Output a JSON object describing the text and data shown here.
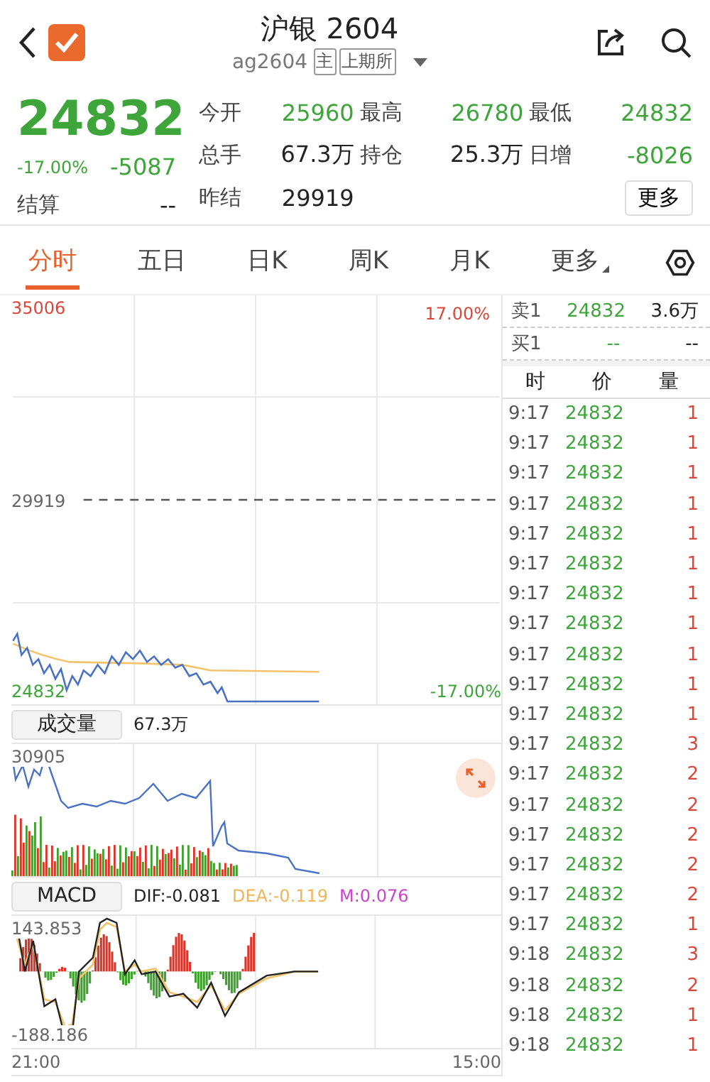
{
  "header": {
    "title": "沪银 2604",
    "code": "ag2604",
    "tags": [
      "主",
      "上期所"
    ]
  },
  "quote": {
    "price": "24832",
    "change_pct": "-17.00%",
    "change": "-5087",
    "stats": [
      {
        "label": "今开",
        "value": "25960",
        "kind": "down"
      },
      {
        "label": "最高",
        "value": "26780",
        "kind": "down"
      },
      {
        "label": "最低",
        "value": "24832",
        "kind": "down"
      },
      {
        "label": "总手",
        "value": "67.3万",
        "kind": "plain"
      },
      {
        "label": "持仓",
        "value": "25.3万",
        "kind": "plain"
      },
      {
        "label": "日增",
        "value": "-8026",
        "kind": "down"
      }
    ],
    "settle": {
      "label": "结算",
      "value": "--"
    },
    "prev_settle": {
      "label": "昨结",
      "value": "29919"
    },
    "more_button": "更多"
  },
  "tabs": [
    {
      "label": "分时",
      "selected": true,
      "kind": "tab"
    },
    {
      "label": "五日",
      "selected": false,
      "kind": "tab"
    },
    {
      "label": "日K",
      "selected": false,
      "kind": "tab"
    },
    {
      "label": "周K",
      "selected": false,
      "kind": "tab"
    },
    {
      "label": "月K",
      "selected": false,
      "kind": "tab"
    },
    {
      "label": "更多",
      "selected": false,
      "kind": "menu"
    }
  ],
  "price_chart": {
    "top_price": "35006",
    "top_pct": "17.00%",
    "mid_price": "29919",
    "bottom_price": "24832",
    "bottom_pct": "-17.00%"
  },
  "volume": {
    "label": "成交量",
    "value": "67.3万",
    "max": "30905"
  },
  "macd": {
    "label": "MACD",
    "dif": "DIF:-0.081",
    "dea": "DEA:-0.119",
    "m": "M:0.076",
    "max": "143.853",
    "min": "-188.186"
  },
  "time_axis": [
    "21:00",
    "15:00"
  ],
  "order_book": [
    {
      "side": "卖1",
      "price": "24832",
      "volume": "3.6万"
    },
    {
      "side": "买1",
      "price": "--",
      "volume": "--"
    }
  ],
  "trades": {
    "columns": [
      "时",
      "价",
      "量"
    ],
    "rows": [
      {
        "time": "9:17",
        "price": "24832",
        "volume": "1"
      },
      {
        "time": "9:17",
        "price": "24832",
        "volume": "1"
      },
      {
        "time": "9:17",
        "price": "24832",
        "volume": "1"
      },
      {
        "time": "9:17",
        "price": "24832",
        "volume": "1"
      },
      {
        "time": "9:17",
        "price": "24832",
        "volume": "1"
      },
      {
        "time": "9:17",
        "price": "24832",
        "volume": "1"
      },
      {
        "time": "9:17",
        "price": "24832",
        "volume": "1"
      },
      {
        "time": "9:17",
        "price": "24832",
        "volume": "1"
      },
      {
        "time": "9:17",
        "price": "24832",
        "volume": "1"
      },
      {
        "time": "9:17",
        "price": "24832",
        "volume": "1"
      },
      {
        "time": "9:17",
        "price": "24832",
        "volume": "1"
      },
      {
        "time": "9:17",
        "price": "24832",
        "volume": "3"
      },
      {
        "time": "9:17",
        "price": "24832",
        "volume": "2"
      },
      {
        "time": "9:17",
        "price": "24832",
        "volume": "2"
      },
      {
        "time": "9:17",
        "price": "24832",
        "volume": "2"
      },
      {
        "time": "9:17",
        "price": "24832",
        "volume": "2"
      },
      {
        "time": "9:17",
        "price": "24832",
        "volume": "2"
      },
      {
        "time": "9:17",
        "price": "24832",
        "volume": "1"
      },
      {
        "time": "9:18",
        "price": "24832",
        "volume": "3"
      },
      {
        "time": "9:18",
        "price": "24832",
        "volume": "2"
      },
      {
        "time": "9:18",
        "price": "24832",
        "volume": "1"
      },
      {
        "time": "9:18",
        "price": "24832",
        "volume": "1"
      }
    ]
  }
}
